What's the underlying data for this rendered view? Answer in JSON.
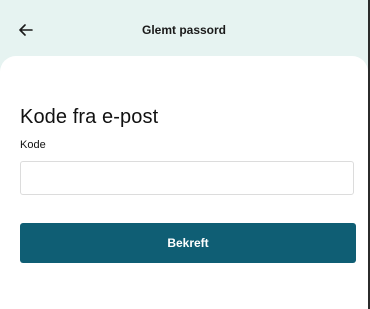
{
  "header": {
    "title": "Glemt passord",
    "back_icon": "arrow-left-icon"
  },
  "form": {
    "heading": "Kode fra e-post",
    "code_label": "Kode",
    "code_value": "",
    "submit_label": "Bekreft"
  },
  "colors": {
    "header_bg": "#e6f3f1",
    "primary": "#0f5e74",
    "text": "#111111"
  }
}
